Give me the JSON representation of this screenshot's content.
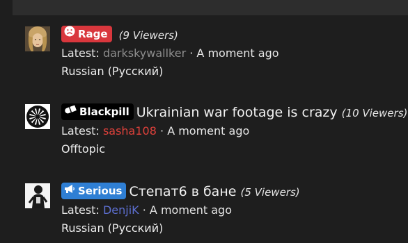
{
  "threads": [
    {
      "badge": {
        "label": "Rage",
        "icon": "sad-face-icon",
        "color": "#d9373d"
      },
      "title": "",
      "viewers": "(9 Viewers)",
      "latest_prefix": "Latest:",
      "latest_user": "darkskywallker",
      "latest_user_color": "#8e8e8e",
      "separator": "·",
      "latest_time": "A moment ago",
      "category": "Russian (Русский)",
      "avatar": "woman-portrait-avatar"
    },
    {
      "badge": {
        "label": "Blackpill",
        "icon": "pill-icon",
        "color": "#000000"
      },
      "title": "Ukrainian war footage is crazy",
      "viewers": "(10 Viewers)",
      "latest_prefix": "Latest:",
      "latest_user": "sasha108",
      "latest_user_color": "#e0413b",
      "separator": "·",
      "latest_time": "A moment ago",
      "category": "Offtopic",
      "avatar": "black-sun-symbol-avatar"
    },
    {
      "badge": {
        "label": "Serious",
        "icon": "megaphone-icon",
        "color": "#2f7fd4"
      },
      "title": "Степат6 в бане",
      "viewers": "(5 Viewers)",
      "latest_prefix": "Latest:",
      "latest_user": "DenjiK",
      "latest_user_color": "#5d6fd0",
      "separator": "·",
      "latest_time": "A moment ago",
      "category": "Russian (Русский)",
      "avatar": "figure-sketch-avatar"
    }
  ]
}
